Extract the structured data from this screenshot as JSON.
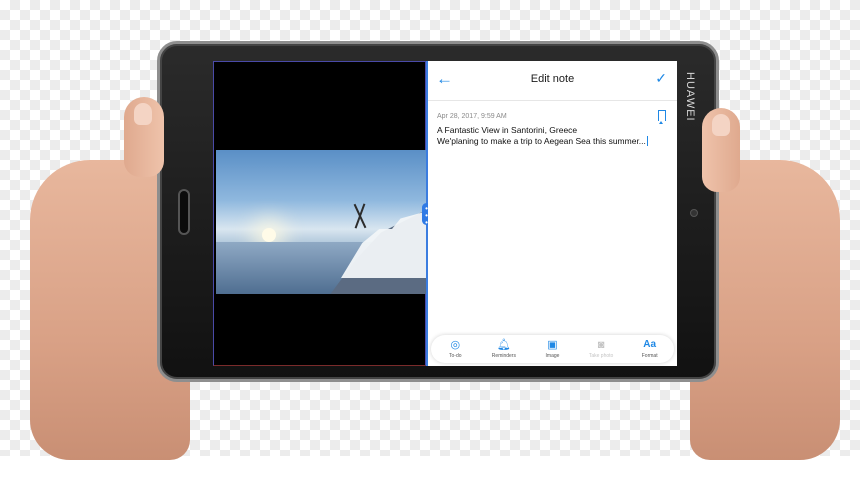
{
  "device": {
    "brand": "HUAWEI"
  },
  "note_app": {
    "title": "Edit note",
    "date": "Apr 28, 2017, 9:59 AM",
    "line1": "A Fantastic View in Santorini, Greece",
    "line2": "We'planing to make a trip to Aegean Sea this summer...",
    "toolbar": [
      {
        "label": "To-do",
        "icon": "check-circle-icon",
        "enabled": true
      },
      {
        "label": "Reminders",
        "icon": "bell-icon",
        "enabled": true
      },
      {
        "label": "Image",
        "icon": "image-icon",
        "enabled": true
      },
      {
        "label": "Take photo",
        "icon": "camera-icon",
        "enabled": false
      },
      {
        "label": "Format",
        "icon": "format-icon",
        "enabled": true,
        "glyph": "Aa"
      }
    ]
  },
  "colors": {
    "accent": "#1f88e5",
    "divider": "#3b7de0"
  }
}
